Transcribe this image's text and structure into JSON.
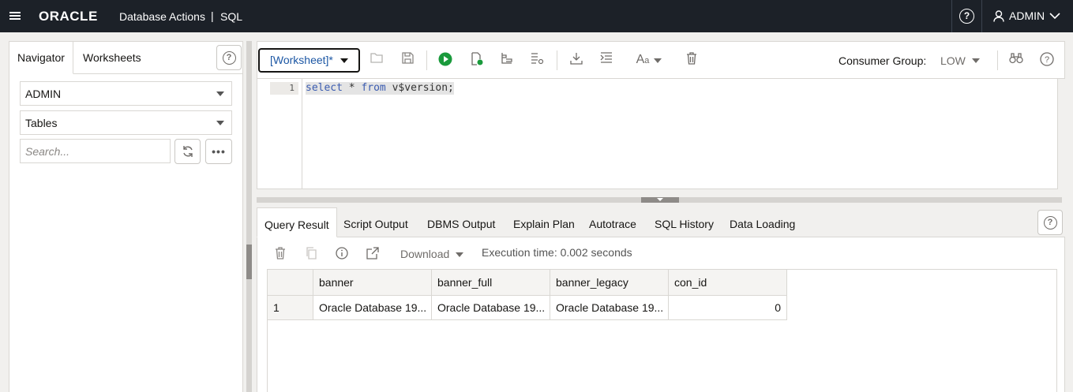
{
  "topbar": {
    "brand": "ORACLE",
    "product": "Database Actions",
    "separator": "|",
    "app": "SQL",
    "user": "ADMIN",
    "bg_color": "#1c2128"
  },
  "navigator": {
    "tabs": [
      "Navigator",
      "Worksheets"
    ],
    "active_tab": "Navigator",
    "schema": "ADMIN",
    "object_type": "Tables",
    "search_placeholder": "Search..."
  },
  "toolbar": {
    "worksheet_label": "[Worksheet]*",
    "consumer_group_label": "Consumer Group:",
    "consumer_group_value": "LOW"
  },
  "editor": {
    "line_number": "1",
    "code_kw1": "select",
    "code_mid": " * ",
    "code_kw2": "from",
    "code_rest": " v$version;"
  },
  "results": {
    "tabs": [
      "Query Result",
      "Script Output",
      "DBMS Output",
      "Explain Plan",
      "Autotrace",
      "SQL History",
      "Data Loading"
    ],
    "active_tab": "Query Result",
    "download_label": "Download",
    "execution_time": "Execution time: 0.002 seconds",
    "columns": [
      "banner",
      "banner_full",
      "banner_legacy",
      "con_id"
    ],
    "rows": [
      {
        "num": "1",
        "cells": [
          "Oracle Database 19...",
          "Oracle Database 19...",
          "Oracle Database 19...",
          "0"
        ]
      }
    ]
  }
}
